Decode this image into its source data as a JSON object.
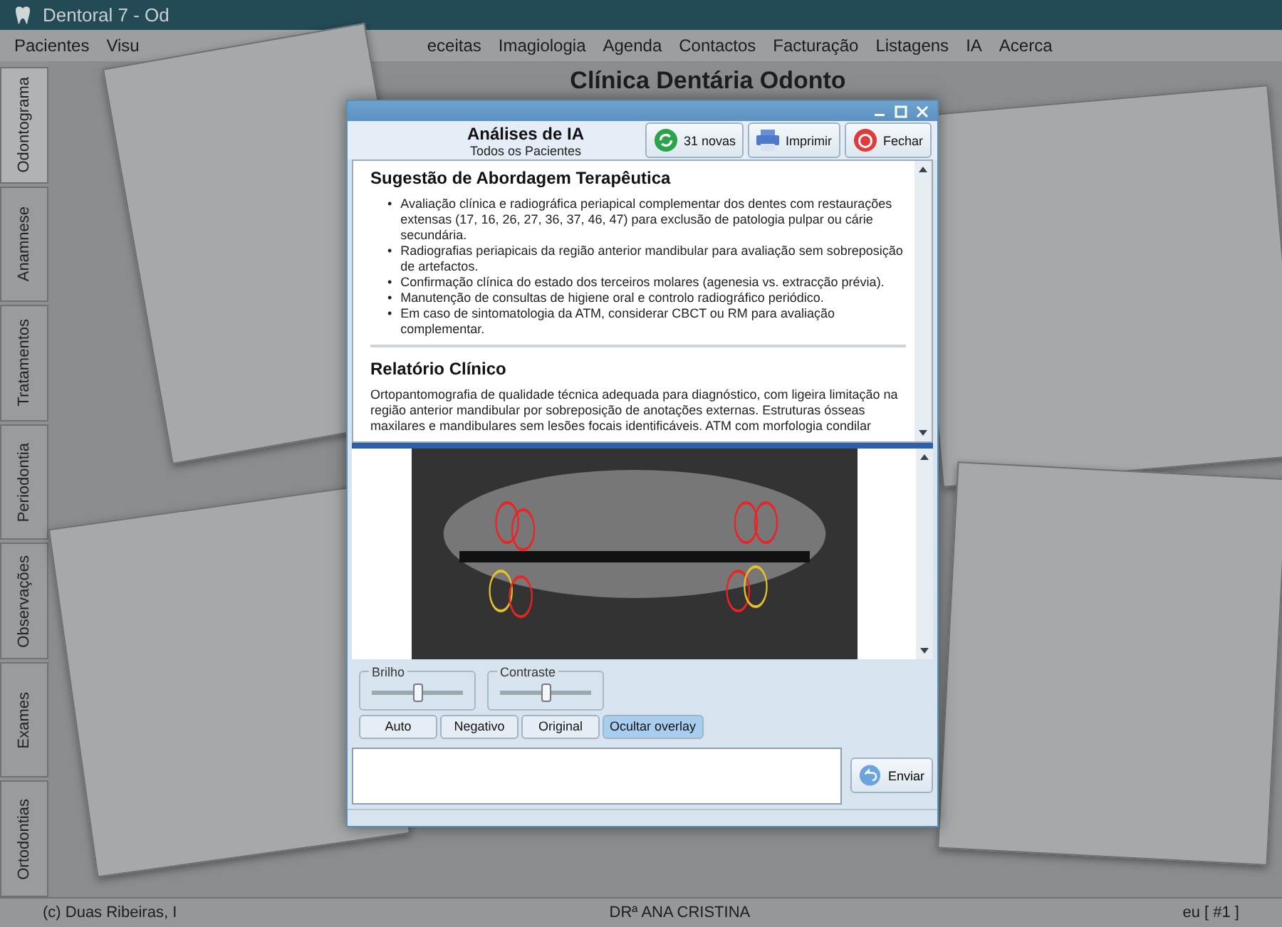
{
  "app": {
    "title": "Dentoral 7 - Od",
    "menu": [
      "Pacientes",
      "Visu",
      "eceitas",
      "Imagiologia",
      "Agenda",
      "Contactos",
      "Facturação",
      "Listagens",
      "IA",
      "Acerca"
    ],
    "heading": "Clínica Dentária Odonto",
    "side_tabs": [
      {
        "label": "Odontograma",
        "selected": true
      },
      {
        "label": "Anamnese",
        "selected": false
      },
      {
        "label": "Tratamentos",
        "selected": false
      },
      {
        "label": "Periodontia",
        "selected": false
      },
      {
        "label": "Observações",
        "selected": false
      },
      {
        "label": "Exames",
        "selected": false
      },
      {
        "label": "Ortodontias",
        "selected": false
      }
    ],
    "status_bar": [
      "(c) Duas Ribeiras, I",
      "DRª ANA CRISTINA",
      "eu [ #1 ]"
    ]
  },
  "dialog": {
    "title": "Análises de IA",
    "subtitle": "Todos os Pacientes",
    "toolbar": [
      {
        "kind": "refresh",
        "label": "31 novas"
      },
      {
        "kind": "print",
        "label": "Imprimir"
      },
      {
        "kind": "close",
        "label": "Fechar"
      }
    ],
    "sections": [
      {
        "heading": "Sugestão de Abordagem Terapêutica",
        "marker": "•",
        "bullets": [
          "Avaliação clínica e radiográfica periapical complementar dos dentes com restaurações extensas (17, 16, 26, 27, 36, 37, 46, 47) para exclusão de patologia pulpar ou cárie secundária.",
          "Radiografias periapicais da região anterior mandibular para avaliação sem sobreposição de artefactos.",
          "Confirmação clínica do estado dos terceiros molares (agenesia vs. extracção prévia).",
          "Manutenção de consultas de higiene oral e controlo radiográfico periódico.",
          "Em caso de sintomatologia da ATM, considerar CBCT ou RM para avaliação complementar."
        ]
      },
      {
        "heading": "Relatório Clínico",
        "paragraph": "Ortopantomografia de qualidade técnica adequada para diagnóstico, com ligeira limitação na região anterior mandibular por sobreposição de anotações externas. Estruturas ósseas maxilares e mandibulares sem lesões focais identificáveis. ATM com morfologia condilar"
      }
    ],
    "sliders": [
      {
        "label": "Brilho",
        "level": 0.5
      },
      {
        "label": "Contraste",
        "level": 0.5
      }
    ],
    "view_buttons": [
      {
        "label": "Auto",
        "selected": false
      },
      {
        "label": "Negativo",
        "selected": false
      },
      {
        "label": "Original",
        "selected": false
      },
      {
        "label": "Ocultar overlay",
        "selected": true
      }
    ],
    "send_button": "Enviar"
  }
}
